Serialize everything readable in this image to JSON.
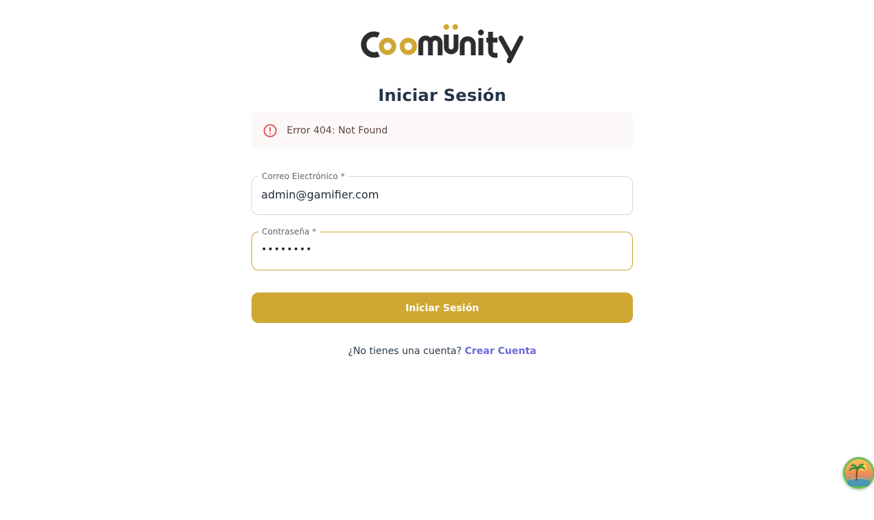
{
  "brand": {
    "logo_text": "Coomünity",
    "accent": "#cfa834",
    "dark": "#2d2d2d"
  },
  "page": {
    "title": "Iniciar Sesión"
  },
  "alert": {
    "message": "Error 404: Not Found",
    "icon": "error-circle-icon",
    "color": "#e24a4a"
  },
  "form": {
    "email": {
      "label": "Correo Electrónico *",
      "value": "admin@gamifier.com"
    },
    "password": {
      "label": "Contraseña *",
      "value": "••••••••"
    },
    "submit_label": "Iniciar Sesión"
  },
  "signup": {
    "prompt": "¿No tienes una cuenta?",
    "link_label": "Crear Cuenta"
  },
  "floating_button": {
    "icon": "beach-island-icon"
  }
}
